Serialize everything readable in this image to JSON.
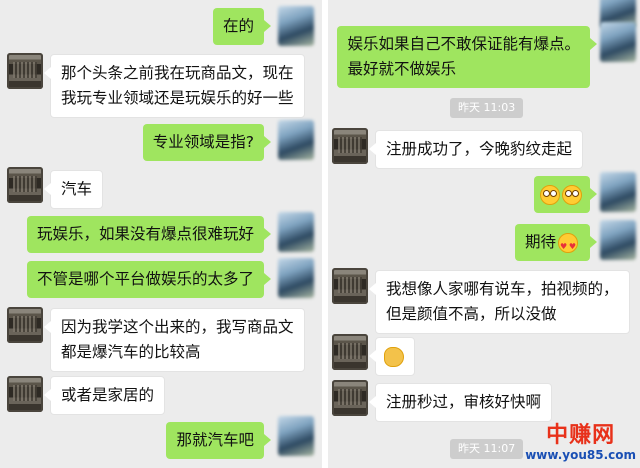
{
  "left_chat": {
    "messages": [
      {
        "dir": "out",
        "text": "在的"
      },
      {
        "dir": "in",
        "lines": [
          "那个头条之前我在玩商品文，现在",
          "我玩专业领域还是玩娱乐的好一些"
        ]
      },
      {
        "dir": "out",
        "text": "专业领域是指?"
      },
      {
        "dir": "in",
        "text": "汽车"
      },
      {
        "dir": "out",
        "text": "玩娱乐，如果没有爆点很难玩好"
      },
      {
        "dir": "out",
        "text": "不管是哪个平台做娱乐的太多了"
      },
      {
        "dir": "in",
        "lines": [
          "因为我学这个出来的，我写商品文",
          "都是爆汽车的比较高"
        ]
      },
      {
        "dir": "in",
        "text": "或者是家居的"
      },
      {
        "dir": "out",
        "text": "那就汽车吧"
      }
    ]
  },
  "right_chat": {
    "messages": [
      {
        "dir": "out",
        "lines": [
          "娱乐如果自己不敢保证能有爆点。",
          "最好就不做娱乐"
        ]
      },
      {
        "timestamp": "昨天 11:03"
      },
      {
        "dir": "in",
        "text": "注册成功了，今晚豹纹走起"
      },
      {
        "dir": "out",
        "emoji": [
          "eyes-emoji",
          "eyes-emoji"
        ]
      },
      {
        "dir": "out",
        "text": "期待",
        "emoji": [
          "heart-eyes-emoji"
        ]
      },
      {
        "dir": "in",
        "lines": [
          "我想像人家哪有说车，拍视频的，",
          "但是颜值不高，所以没做"
        ]
      },
      {
        "dir": "in",
        "emoji": [
          "fist-emoji"
        ]
      },
      {
        "dir": "in",
        "text": "注册秒过，审核好快啊"
      },
      {
        "timestamp": "昨天 11:07"
      }
    ]
  },
  "watermark": {
    "title": "中赚网",
    "url": "www.you85.com"
  },
  "colors": {
    "background": "#ececec",
    "outgoing_bubble": "#9fe55f",
    "incoming_bubble": "#ffffff",
    "timestamp_bg": "#cdcdcd",
    "watermark_red": "#e8311a",
    "watermark_blue": "#1a4fb4"
  }
}
